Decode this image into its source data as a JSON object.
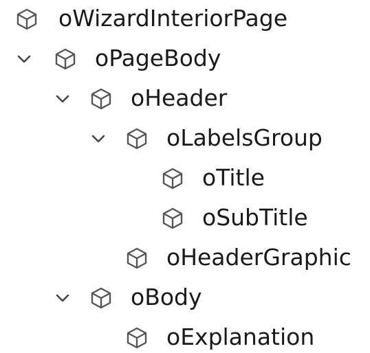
{
  "tree": {
    "nodes": [
      {
        "label": "oWizardInteriorPage",
        "depth": 0,
        "expanded": null,
        "icon": "cube-icon"
      },
      {
        "label": "oPageBody",
        "depth": 0,
        "expanded": true,
        "icon": "cube-icon"
      },
      {
        "label": "oHeader",
        "depth": 1,
        "expanded": true,
        "icon": "cube-icon"
      },
      {
        "label": "oLabelsGroup",
        "depth": 2,
        "expanded": true,
        "icon": "cube-icon"
      },
      {
        "label": "oTitle",
        "depth": 3,
        "expanded": null,
        "icon": "cube-icon"
      },
      {
        "label": "oSubTitle",
        "depth": 3,
        "expanded": null,
        "icon": "cube-icon"
      },
      {
        "label": "oHeaderGraphic",
        "depth": 2,
        "expanded": null,
        "icon": "cube-icon"
      },
      {
        "label": "oBody",
        "depth": 1,
        "expanded": true,
        "icon": "cube-icon"
      },
      {
        "label": "oExplanation",
        "depth": 2,
        "expanded": null,
        "icon": "cube-icon"
      }
    ]
  }
}
